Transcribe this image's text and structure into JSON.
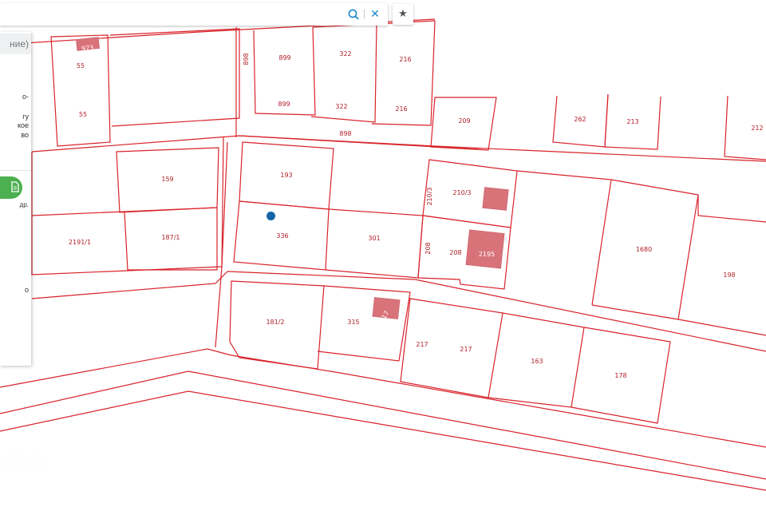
{
  "search": {
    "value": "",
    "placeholder": ""
  },
  "icons": {
    "search": "search-icon",
    "close": "close-icon",
    "star": "star-icon",
    "document": "document-icon"
  },
  "favorite_glyph": "★",
  "close_glyph": "✕",
  "panel": {
    "header_fragment": "ние)",
    "fragments": [
      "о-",
      "гу",
      "кое",
      "во",
      "о"
    ],
    "more_link": "др."
  },
  "watermark": "лик",
  "colors": {
    "parcel_line": "#d8232a",
    "building_fill": "#d9737a",
    "location_dot": "#1565a8",
    "button_green": "#4caf50",
    "accent_blue": "#1e88c8"
  },
  "parcels": [
    {
      "label": "973"
    },
    {
      "label": "55"
    },
    {
      "label": "55"
    },
    {
      "label": "898"
    },
    {
      "label": "899"
    },
    {
      "label": "899"
    },
    {
      "label": "322"
    },
    {
      "label": "322"
    },
    {
      "label": "216"
    },
    {
      "label": "216"
    },
    {
      "label": "209"
    },
    {
      "label": "262"
    },
    {
      "label": "213"
    },
    {
      "label": "212"
    },
    {
      "label": "898"
    },
    {
      "label": "193"
    },
    {
      "label": "159"
    },
    {
      "label": "210/3"
    },
    {
      "label": "210/3"
    },
    {
      "label": "336"
    },
    {
      "label": "2191/1"
    },
    {
      "label": "187/1"
    },
    {
      "label": "301"
    },
    {
      "label": "208"
    },
    {
      "label": "208"
    },
    {
      "label": "2195"
    },
    {
      "label": "1680"
    },
    {
      "label": "198"
    },
    {
      "label": "181/2"
    },
    {
      "label": "315"
    },
    {
      "label": "217"
    },
    {
      "label": "217"
    },
    {
      "label": "217"
    },
    {
      "label": "163"
    },
    {
      "label": "178"
    }
  ]
}
